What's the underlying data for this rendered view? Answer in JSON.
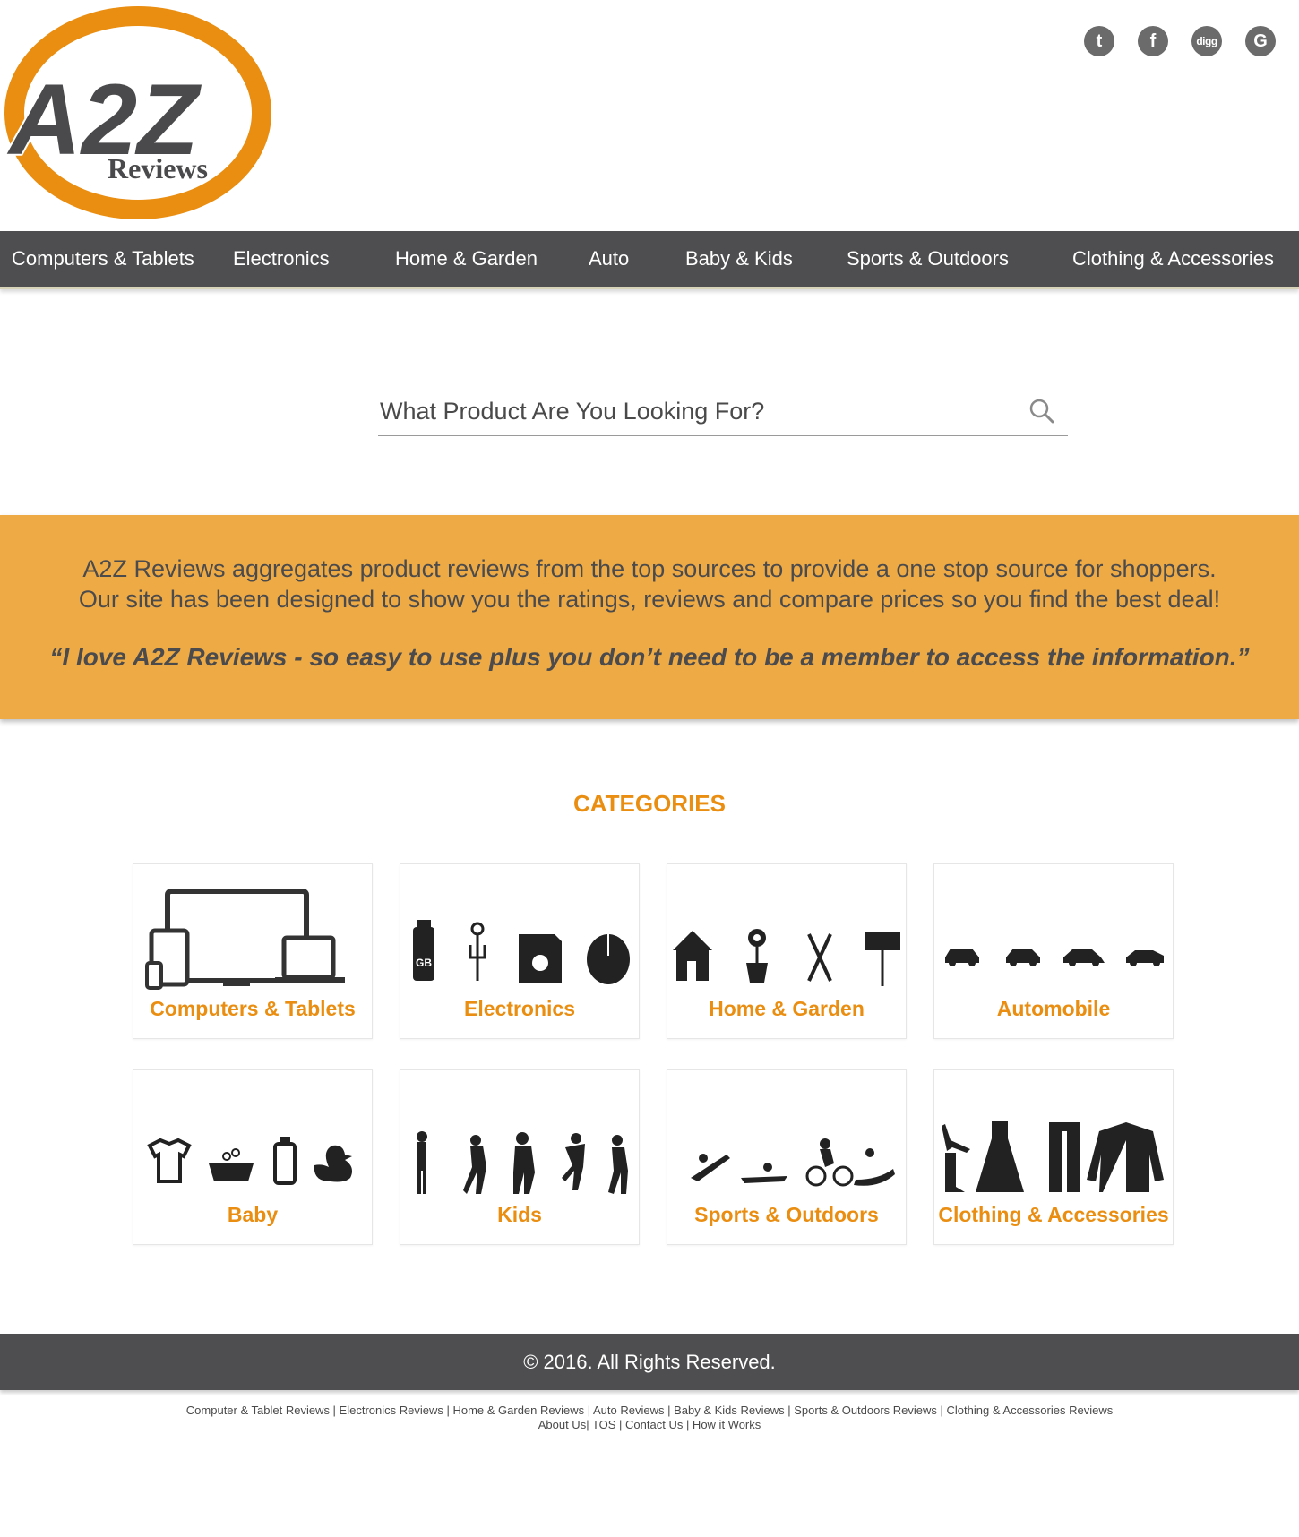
{
  "logo": {
    "brand": "A2Z",
    "sub": "Reviews"
  },
  "social": [
    {
      "name": "twitter-icon",
      "glyph": "t"
    },
    {
      "name": "facebook-icon",
      "glyph": "f"
    },
    {
      "name": "digg-icon",
      "glyph": "digg"
    },
    {
      "name": "google-icon",
      "glyph": "G"
    }
  ],
  "nav": [
    "Computers & Tablets",
    "Electronics",
    "Home & Garden",
    "Auto",
    "Baby & Kids",
    "Sports & Outdoors",
    "Clothing & Accessories"
  ],
  "search": {
    "placeholder": "What Product Are You Looking For?"
  },
  "banner": {
    "line1": "A2Z Reviews aggregates product reviews from the top sources to provide a one stop source for shoppers.",
    "line2": "Our site has been designed to show you the ratings, reviews and compare prices so you find the best deal!",
    "quote": "“I love A2Z Reviews - so easy to use plus you don’t need to be a member to access the information.”"
  },
  "categories": {
    "title": "CATEGORIES",
    "items": [
      {
        "label": "Computers & Tablets",
        "icon": "devices-icon"
      },
      {
        "label": "Electronics",
        "icon": "electronics-icon"
      },
      {
        "label": "Home & Garden",
        "icon": "home-garden-icon"
      },
      {
        "label": "Automobile",
        "icon": "cars-icon"
      },
      {
        "label": "Baby",
        "icon": "baby-icon"
      },
      {
        "label": "Kids",
        "icon": "kids-icon"
      },
      {
        "label": "Sports & Outdoors",
        "icon": "sports-icon"
      },
      {
        "label": "Clothing & Accessories",
        "icon": "clothing-icon"
      }
    ]
  },
  "footer": {
    "copyright": "© 2016. All Rights Reserved.",
    "links_row1": "Computer & Tablet Reviews | Electronics Reviews | Home & Garden Reviews | Auto Reviews | Baby & Kids Reviews | Sports & Outdoors Reviews | Clothing & Accessories Reviews",
    "links_row2": "About Us| TOS | Contact Us | How it Works"
  },
  "colors": {
    "accent": "#ea8e12",
    "banner": "#eeab45",
    "dark": "#4e4d4f"
  }
}
